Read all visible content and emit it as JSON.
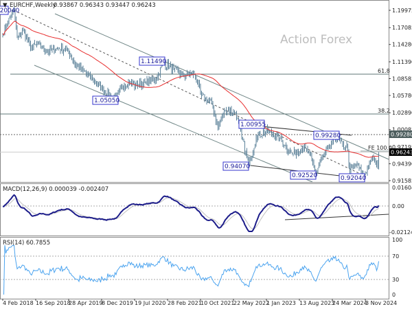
{
  "chart_data": [
    {
      "type": "ohlc",
      "symbol": "EURCHF",
      "timeframe": "Weekly",
      "title": "EURCHF,Weekly",
      "last_bar": {
        "open": "0.93867",
        "high": "0.96343",
        "low": "0.93447",
        "close": "0.96243"
      },
      "price_ticks": [
        "1.19975",
        "1.17085",
        "1.14280",
        "1.11390",
        "1.08585",
        "1.05780",
        "1.02890",
        "1.00085",
        "0.97195",
        "0.94390",
        "0.91585"
      ],
      "ylim": [
        0.91585,
        1.19975
      ],
      "date_ticks": [
        "4 Feb 2018",
        "16 Sep 2018",
        "28 Apr 2019",
        "8 Dec 2019",
        "19 Jul 2020",
        "28 Feb 2021",
        "10 Oct 2021",
        "22 May 2022",
        "1 Jan 2023",
        "13 Aug 2023",
        "24 Mar 2024",
        "3 Nov 2024"
      ],
      "approx_closes": [
        [
          "2018-02-04",
          1.16
        ],
        [
          "2018-03-04",
          1.177
        ],
        [
          "2018-04-22",
          1.2
        ],
        [
          "2018-05-13",
          1.154
        ],
        [
          "2018-06-24",
          1.165
        ],
        [
          "2018-08-12",
          1.137
        ],
        [
          "2018-09-30",
          1.143
        ],
        [
          "2018-12-09",
          1.131
        ],
        [
          "2019-02-17",
          1.137
        ],
        [
          "2019-04-28",
          1.131
        ],
        [
          "2019-06-16",
          1.108
        ],
        [
          "2019-07-28",
          1.1
        ],
        [
          "2019-10-06",
          1.085
        ],
        [
          "2019-12-15",
          1.068
        ],
        [
          "2020-03-15",
          1.052
        ],
        [
          "2020-05-03",
          1.074
        ],
        [
          "2020-06-14",
          1.08
        ],
        [
          "2020-07-26",
          1.074
        ],
        [
          "2020-10-04",
          1.08
        ],
        [
          "2020-12-13",
          1.086
        ],
        [
          "2021-01-31",
          1.113
        ],
        [
          "2021-04-11",
          1.1
        ],
        [
          "2021-06-20",
          1.091
        ],
        [
          "2021-08-29",
          1.094
        ],
        [
          "2021-10-17",
          1.057
        ],
        [
          "2021-12-26",
          1.045
        ],
        [
          "2022-02-06",
          1.005
        ],
        [
          "2022-03-27",
          1.034
        ],
        [
          "2022-06-05",
          1.03
        ],
        [
          "2022-07-17",
          0.988
        ],
        [
          "2022-09-04",
          0.942
        ],
        [
          "2022-10-23",
          0.988
        ],
        [
          "2023-01-01",
          0.999
        ],
        [
          "2023-02-12",
          0.993
        ],
        [
          "2023-04-02",
          0.988
        ],
        [
          "2023-05-14",
          0.971
        ],
        [
          "2023-06-25",
          0.96
        ],
        [
          "2023-09-03",
          0.971
        ],
        [
          "2023-10-22",
          0.96
        ],
        [
          "2023-12-03",
          0.928
        ],
        [
          "2024-01-14",
          0.954
        ],
        [
          "2024-03-24",
          0.977
        ],
        [
          "2024-04-14",
          0.991
        ],
        [
          "2024-06-09",
          0.971
        ],
        [
          "2024-06-30",
          0.977
        ],
        [
          "2024-07-21",
          0.932
        ],
        [
          "2024-09-08",
          0.943
        ],
        [
          "2024-10-20",
          0.923
        ],
        [
          "2024-12-08",
          0.948
        ],
        [
          "2024-12-29",
          0.954
        ],
        [
          "2025-01-19",
          0.938
        ],
        [
          "2025-02-02",
          0.962
        ]
      ],
      "moving_average_color": "#e82e2e",
      "bar_color": "#5b8198",
      "swing_labels": [
        "1.20040",
        "1.11490",
        "1.05050",
        "1.00955",
        "0.99280",
        "0.94070",
        "0.92520",
        "0.92040"
      ],
      "fib_levels": [
        "61.8",
        "38.2"
      ],
      "projection_label": "FE 100.0",
      "marked_price": "0.99280",
      "current_price": "0.96243",
      "watermark": "Action Forex"
    },
    {
      "type": "line",
      "title": "MACD(12,26,9) 0.000039 -0.002407",
      "params": [
        12,
        26,
        9
      ],
      "ticks": [
        "0.016046",
        "0.00",
        "-0.021248"
      ],
      "ylim": [
        -0.021248,
        0.016046
      ],
      "main_color": "#1c1c8a",
      "signal_color": "#c0c0c0"
    },
    {
      "type": "line",
      "title": "RSI(14) 60.7855",
      "period": 14,
      "ticks": [
        "100",
        "70",
        "30",
        "0"
      ],
      "ylim": [
        0,
        100
      ],
      "levels": [
        70,
        30
      ],
      "color": "#4aa3ef"
    }
  ]
}
